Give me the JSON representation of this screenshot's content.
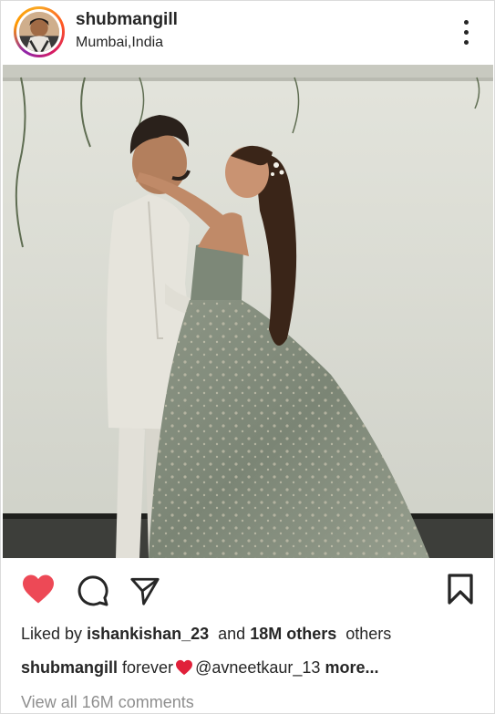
{
  "post": {
    "username": "shubmangill",
    "location": "Mumbai,India",
    "photo_icon": "couple-photo",
    "liked_by_prefix": "Liked by",
    "liked_by_user": "ishankishan_23",
    "liked_and": "and",
    "liked_count": "18M others",
    "liked_suffix": "others",
    "caption_user": "shubmangill",
    "caption_text": "forever",
    "caption_emoji": "red-heart-emoji",
    "caption_mention": "@avneetkaur_13",
    "caption_more": "more...",
    "view_comments": "View all 16M comments"
  },
  "icons": {
    "more": "more-vertical-icon",
    "like": "heart-icon",
    "comment": "comment-icon",
    "share": "send-icon",
    "save": "bookmark-icon"
  },
  "colors": {
    "like_active": "#ed4956",
    "text": "#262626",
    "muted": "#8e8e8e"
  }
}
